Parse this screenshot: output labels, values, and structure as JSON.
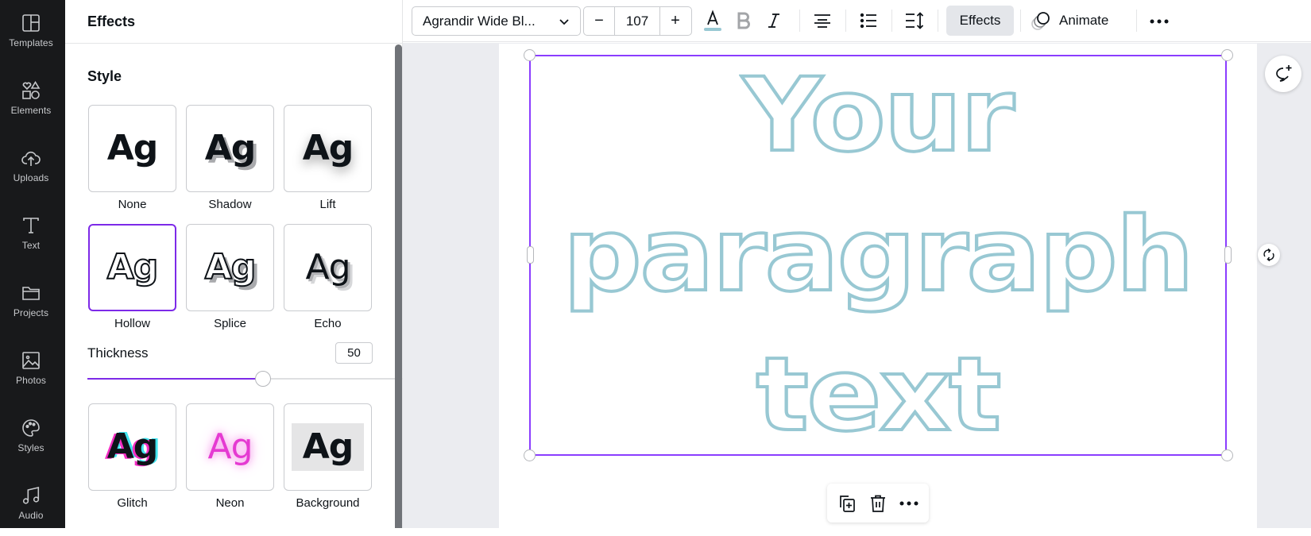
{
  "sidebar": {
    "items": [
      {
        "label": "Templates",
        "icon": "templates-icon"
      },
      {
        "label": "Elements",
        "icon": "elements-icon"
      },
      {
        "label": "Uploads",
        "icon": "uploads-icon"
      },
      {
        "label": "Text",
        "icon": "text-icon"
      },
      {
        "label": "Projects",
        "icon": "projects-icon"
      },
      {
        "label": "Photos",
        "icon": "photos-icon"
      },
      {
        "label": "Styles",
        "icon": "styles-icon"
      },
      {
        "label": "Audio",
        "icon": "audio-icon"
      }
    ]
  },
  "panel": {
    "title": "Effects",
    "style_section": "Style",
    "sample_text": "Ag",
    "styles": [
      {
        "label": "None",
        "selected": false
      },
      {
        "label": "Shadow",
        "selected": false
      },
      {
        "label": "Lift",
        "selected": false
      },
      {
        "label": "Hollow",
        "selected": true
      },
      {
        "label": "Splice",
        "selected": false
      },
      {
        "label": "Echo",
        "selected": false
      },
      {
        "label": "Glitch",
        "selected": false
      },
      {
        "label": "Neon",
        "selected": false
      },
      {
        "label": "Background",
        "selected": false
      }
    ],
    "thickness": {
      "label": "Thickness",
      "value": "50",
      "min": 0,
      "max": 100
    }
  },
  "toolbar": {
    "font": "Agrandir Wide Bl...",
    "font_size": "107",
    "minus": "−",
    "plus": "+",
    "text_color_swatch": "#98c8d3",
    "effects_label": "Effects",
    "animate_label": "Animate"
  },
  "canvas": {
    "lines": [
      "Your",
      "paragraph",
      "text"
    ],
    "text_stroke_color": "#98c8d3",
    "selection_color": "#8b3dff"
  },
  "colors": {
    "accent": "#7d2ae8",
    "rail_bg": "#18191b",
    "workspace_bg": "#ebecf0"
  }
}
